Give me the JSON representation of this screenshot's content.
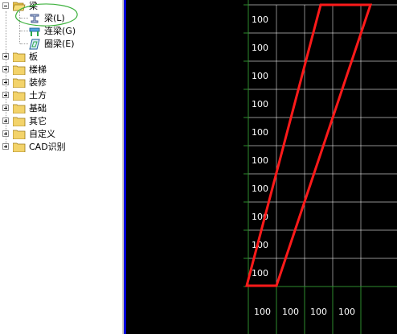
{
  "tree": {
    "root": {
      "label": "梁",
      "expanded": true
    },
    "children": [
      {
        "label": "梁(L)",
        "icon": "beam-icon"
      },
      {
        "label": "连梁(G)",
        "icon": "link-beam-icon"
      },
      {
        "label": "圈梁(E)",
        "icon": "ring-beam-icon"
      }
    ],
    "items": [
      {
        "label": "板"
      },
      {
        "label": "楼梯"
      },
      {
        "label": "装修"
      },
      {
        "label": "土方"
      },
      {
        "label": "基础"
      },
      {
        "label": "其它"
      },
      {
        "label": "自定义"
      },
      {
        "label": "CAD识别"
      }
    ]
  },
  "canvas": {
    "row_labels": [
      "100",
      "100",
      "100",
      "100",
      "100",
      "100",
      "100",
      "100",
      "100",
      "100"
    ],
    "col_labels": [
      "100",
      "100",
      "100",
      "100"
    ],
    "colors": {
      "background": "#000000",
      "grid": "#ffffff",
      "axis": "#2e8b2e",
      "shape": "#ff1a1a",
      "text": "#ffffff"
    }
  }
}
